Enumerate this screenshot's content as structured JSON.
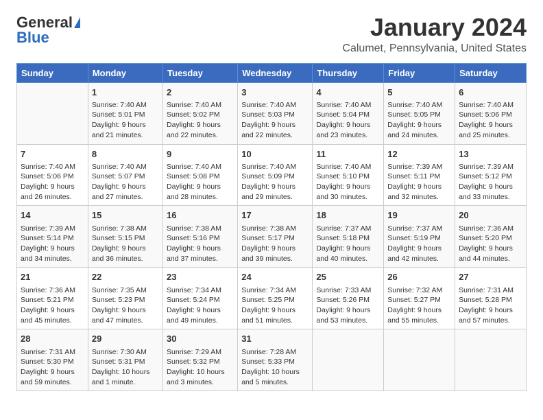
{
  "logo": {
    "line1": "General",
    "line2": "Blue"
  },
  "title": "January 2024",
  "subtitle": "Calumet, Pennsylvania, United States",
  "header_days": [
    "Sunday",
    "Monday",
    "Tuesday",
    "Wednesday",
    "Thursday",
    "Friday",
    "Saturday"
  ],
  "weeks": [
    [
      {
        "day": "",
        "info": ""
      },
      {
        "day": "1",
        "info": "Sunrise: 7:40 AM\nSunset: 5:01 PM\nDaylight: 9 hours\nand 21 minutes."
      },
      {
        "day": "2",
        "info": "Sunrise: 7:40 AM\nSunset: 5:02 PM\nDaylight: 9 hours\nand 22 minutes."
      },
      {
        "day": "3",
        "info": "Sunrise: 7:40 AM\nSunset: 5:03 PM\nDaylight: 9 hours\nand 22 minutes."
      },
      {
        "day": "4",
        "info": "Sunrise: 7:40 AM\nSunset: 5:04 PM\nDaylight: 9 hours\nand 23 minutes."
      },
      {
        "day": "5",
        "info": "Sunrise: 7:40 AM\nSunset: 5:05 PM\nDaylight: 9 hours\nand 24 minutes."
      },
      {
        "day": "6",
        "info": "Sunrise: 7:40 AM\nSunset: 5:06 PM\nDaylight: 9 hours\nand 25 minutes."
      }
    ],
    [
      {
        "day": "7",
        "info": "Sunrise: 7:40 AM\nSunset: 5:06 PM\nDaylight: 9 hours\nand 26 minutes."
      },
      {
        "day": "8",
        "info": "Sunrise: 7:40 AM\nSunset: 5:07 PM\nDaylight: 9 hours\nand 27 minutes."
      },
      {
        "day": "9",
        "info": "Sunrise: 7:40 AM\nSunset: 5:08 PM\nDaylight: 9 hours\nand 28 minutes."
      },
      {
        "day": "10",
        "info": "Sunrise: 7:40 AM\nSunset: 5:09 PM\nDaylight: 9 hours\nand 29 minutes."
      },
      {
        "day": "11",
        "info": "Sunrise: 7:40 AM\nSunset: 5:10 PM\nDaylight: 9 hours\nand 30 minutes."
      },
      {
        "day": "12",
        "info": "Sunrise: 7:39 AM\nSunset: 5:11 PM\nDaylight: 9 hours\nand 32 minutes."
      },
      {
        "day": "13",
        "info": "Sunrise: 7:39 AM\nSunset: 5:12 PM\nDaylight: 9 hours\nand 33 minutes."
      }
    ],
    [
      {
        "day": "14",
        "info": "Sunrise: 7:39 AM\nSunset: 5:14 PM\nDaylight: 9 hours\nand 34 minutes."
      },
      {
        "day": "15",
        "info": "Sunrise: 7:38 AM\nSunset: 5:15 PM\nDaylight: 9 hours\nand 36 minutes."
      },
      {
        "day": "16",
        "info": "Sunrise: 7:38 AM\nSunset: 5:16 PM\nDaylight: 9 hours\nand 37 minutes."
      },
      {
        "day": "17",
        "info": "Sunrise: 7:38 AM\nSunset: 5:17 PM\nDaylight: 9 hours\nand 39 minutes."
      },
      {
        "day": "18",
        "info": "Sunrise: 7:37 AM\nSunset: 5:18 PM\nDaylight: 9 hours\nand 40 minutes."
      },
      {
        "day": "19",
        "info": "Sunrise: 7:37 AM\nSunset: 5:19 PM\nDaylight: 9 hours\nand 42 minutes."
      },
      {
        "day": "20",
        "info": "Sunrise: 7:36 AM\nSunset: 5:20 PM\nDaylight: 9 hours\nand 44 minutes."
      }
    ],
    [
      {
        "day": "21",
        "info": "Sunrise: 7:36 AM\nSunset: 5:21 PM\nDaylight: 9 hours\nand 45 minutes."
      },
      {
        "day": "22",
        "info": "Sunrise: 7:35 AM\nSunset: 5:23 PM\nDaylight: 9 hours\nand 47 minutes."
      },
      {
        "day": "23",
        "info": "Sunrise: 7:34 AM\nSunset: 5:24 PM\nDaylight: 9 hours\nand 49 minutes."
      },
      {
        "day": "24",
        "info": "Sunrise: 7:34 AM\nSunset: 5:25 PM\nDaylight: 9 hours\nand 51 minutes."
      },
      {
        "day": "25",
        "info": "Sunrise: 7:33 AM\nSunset: 5:26 PM\nDaylight: 9 hours\nand 53 minutes."
      },
      {
        "day": "26",
        "info": "Sunrise: 7:32 AM\nSunset: 5:27 PM\nDaylight: 9 hours\nand 55 minutes."
      },
      {
        "day": "27",
        "info": "Sunrise: 7:31 AM\nSunset: 5:28 PM\nDaylight: 9 hours\nand 57 minutes."
      }
    ],
    [
      {
        "day": "28",
        "info": "Sunrise: 7:31 AM\nSunset: 5:30 PM\nDaylight: 9 hours\nand 59 minutes."
      },
      {
        "day": "29",
        "info": "Sunrise: 7:30 AM\nSunset: 5:31 PM\nDaylight: 10 hours\nand 1 minute."
      },
      {
        "day": "30",
        "info": "Sunrise: 7:29 AM\nSunset: 5:32 PM\nDaylight: 10 hours\nand 3 minutes."
      },
      {
        "day": "31",
        "info": "Sunrise: 7:28 AM\nSunset: 5:33 PM\nDaylight: 10 hours\nand 5 minutes."
      },
      {
        "day": "",
        "info": ""
      },
      {
        "day": "",
        "info": ""
      },
      {
        "day": "",
        "info": ""
      }
    ]
  ]
}
